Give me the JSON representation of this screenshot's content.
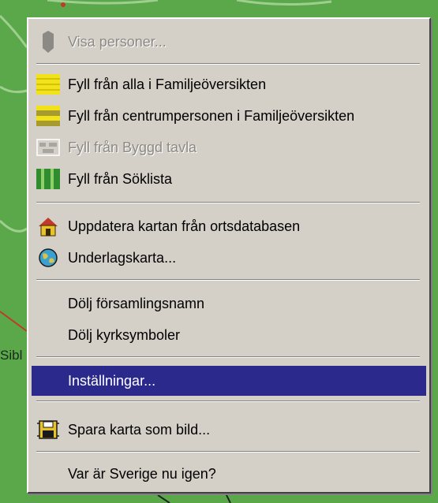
{
  "map": {
    "label": "Sibl"
  },
  "menu": {
    "items": [
      {
        "label": "Visa personer...",
        "icon": "person-silhouette-icon",
        "disabled": true
      },
      {
        "label": "Fyll från alla i Familjeöversikten",
        "icon": "yellow-grid-icon",
        "disabled": false
      },
      {
        "label": "Fyll från centrumpersonen i Familjeöversikten",
        "icon": "yellow-olive-grid-icon",
        "disabled": false
      },
      {
        "label": "Fyll från Byggd tavla",
        "icon": "board-icon",
        "disabled": true
      },
      {
        "label": "Fyll från Söklista",
        "icon": "green-list-icon",
        "disabled": false
      },
      {
        "label": "Uppdatera kartan från ortsdatabasen",
        "icon": "house-icon",
        "disabled": false
      },
      {
        "label": "Underlagskarta...",
        "icon": "globe-icon",
        "disabled": false
      },
      {
        "label": "Dölj församlingsnamn",
        "icon": "",
        "disabled": false
      },
      {
        "label": "Dölj kyrksymboler",
        "icon": "",
        "disabled": false
      },
      {
        "label": "Inställningar...",
        "icon": "",
        "disabled": false,
        "selected": true
      },
      {
        "label": "Spara karta som bild...",
        "icon": "save-map-icon",
        "disabled": false
      },
      {
        "label": "Var är Sverige nu igen?",
        "icon": "",
        "disabled": false
      }
    ]
  },
  "colors": {
    "menu_bg": "#d4d0c8",
    "highlight": "#2b2a8c",
    "map_green": "#5aa84a"
  }
}
